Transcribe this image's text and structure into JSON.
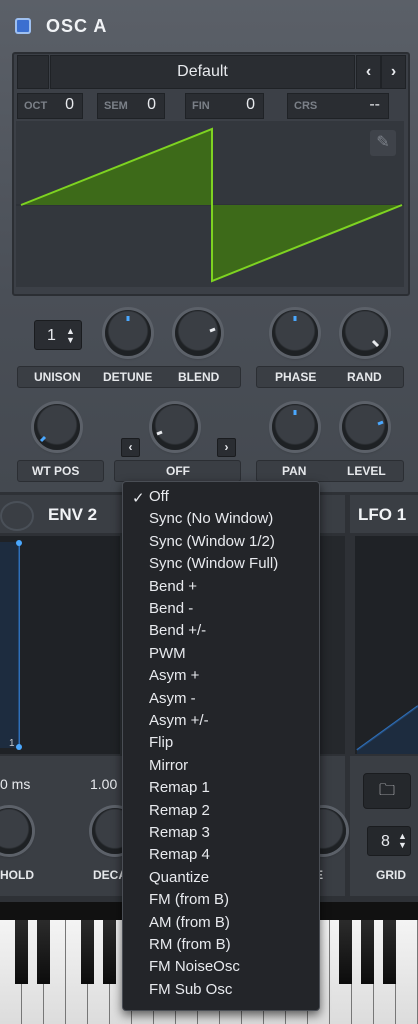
{
  "osc": {
    "title": "OSC A",
    "wavetable": "Default",
    "prev": "‹",
    "next": "›",
    "pitch": [
      {
        "label": "OCT",
        "value": "0"
      },
      {
        "label": "SEM",
        "value": "0"
      },
      {
        "label": "FIN",
        "value": "0"
      },
      {
        "label": "CRS",
        "value": "--"
      }
    ],
    "unison_value": "1",
    "labels": {
      "unison": "UNISON",
      "detune": "DETUNE",
      "blend": "BLEND",
      "phase": "PHASE",
      "rand": "RAND",
      "wt_pos": "WT POS",
      "warp": "OFF",
      "pan": "PAN",
      "level": "LEVEL"
    }
  },
  "env": {
    "title": "ENV 2",
    "hold_value": "0 ms",
    "decay_value": "1.00",
    "hold_label": "HOLD",
    "decay_label": "DECA",
    "e_label": "E",
    "graph_value": "1"
  },
  "lfo": {
    "title": "LFO 1",
    "grid_value": "8",
    "grid_label": "GRID"
  },
  "menu": {
    "items": [
      "Off",
      "Sync (No Window)",
      "Sync (Window 1/2)",
      "Sync (Window Full)",
      "Bend +",
      "Bend -",
      "Bend +/-",
      "PWM",
      "Asym +",
      "Asym -",
      "Asym +/-",
      "Flip",
      "Mirror",
      "Remap 1",
      "Remap 2",
      "Remap 3",
      "Remap 4",
      "Quantize",
      "FM (from B)",
      "AM (from B)",
      "RM (from B)",
      "FM NoiseOsc",
      "FM Sub Osc"
    ],
    "selected": "Off",
    "check": "✓"
  },
  "colors": {
    "accent": "#7ed321",
    "knob_indicator": "#4aa8ff",
    "background": "#2a2d31"
  }
}
